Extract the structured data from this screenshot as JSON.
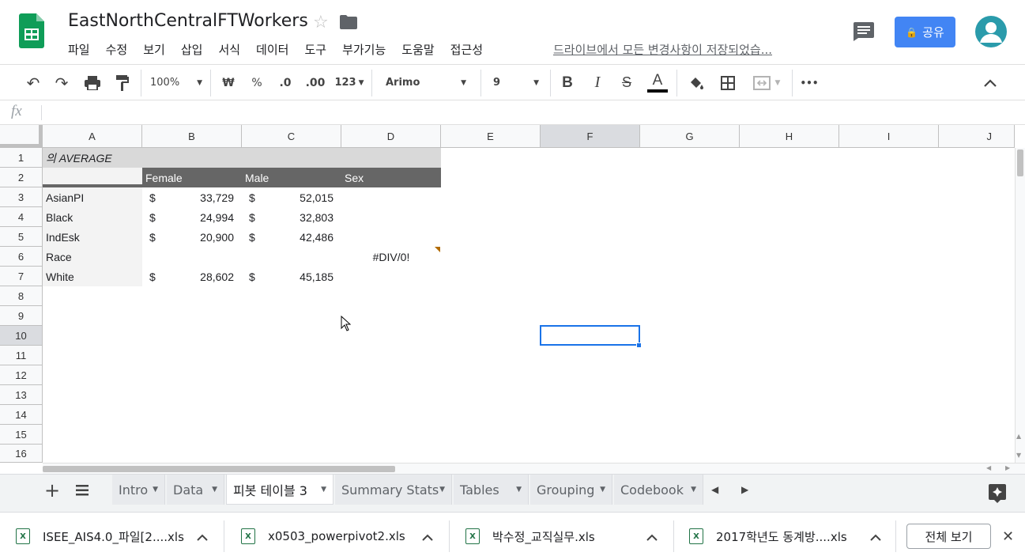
{
  "app": {
    "doc_title": "EastNorthCentralFTWorkers",
    "menu": [
      "파일",
      "수정",
      "보기",
      "삽입",
      "서식",
      "데이터",
      "도구",
      "부가기능",
      "도움말",
      "접근성"
    ],
    "saved_status": "드라이브에서 모든 변경사항이 저장되었습...",
    "share_label": "공유",
    "accent_color": "#4285f4"
  },
  "toolbar": {
    "zoom": "100%",
    "currency": "₩",
    "percent": "%",
    "dec_decrease": ".0",
    "dec_increase": ".00",
    "number_format": "123",
    "font": "Arimo",
    "font_size": "9",
    "bold": "B",
    "italic": "I",
    "strike": "S",
    "text_color": "A",
    "more": "•••"
  },
  "formula_bar": {
    "fx": "fx",
    "value": ""
  },
  "columns": [
    "A",
    "B",
    "C",
    "D",
    "E",
    "F",
    "G",
    "H",
    "I",
    "J"
  ],
  "rows": [
    "1",
    "2",
    "3",
    "4",
    "5",
    "6",
    "7",
    "8",
    "9",
    "10",
    "11",
    "12",
    "13",
    "14",
    "15",
    "16"
  ],
  "pivot": {
    "title": "의 AVERAGE",
    "headers": [
      "Female",
      "Male",
      "Sex"
    ],
    "records": [
      {
        "label": "AsianPI",
        "cur1": "$",
        "female": "33,729",
        "cur2": "$",
        "male": "52,015",
        "sex": ""
      },
      {
        "label": "Black",
        "cur1": "$",
        "female": "24,994",
        "cur2": "$",
        "male": "32,803",
        "sex": ""
      },
      {
        "label": "IndEsk",
        "cur1": "$",
        "female": "20,900",
        "cur2": "$",
        "male": "42,486",
        "sex": ""
      },
      {
        "label": "Race",
        "cur1": "",
        "female": "",
        "cur2": "",
        "male": "",
        "sex": "#DIV/0!"
      },
      {
        "label": "White",
        "cur1": "$",
        "female": "28,602",
        "cur2": "$",
        "male": "45,185",
        "sex": ""
      }
    ]
  },
  "selected_cell": "F10",
  "sheet_tabs": [
    "Intro",
    "Data",
    "피봇 테이블 3",
    "Summary Stats",
    "Tables",
    "Grouping",
    "Codebook"
  ],
  "active_tab": "피봇 테이블 3",
  "downloads": [
    "ISEE_AIS4.0_파일[2....xls",
    "x0503_powerpivot2.xls",
    "박수정_교직실무.xls",
    "2017학년도 동계방....xls"
  ],
  "show_all_label": "전체 보기"
}
